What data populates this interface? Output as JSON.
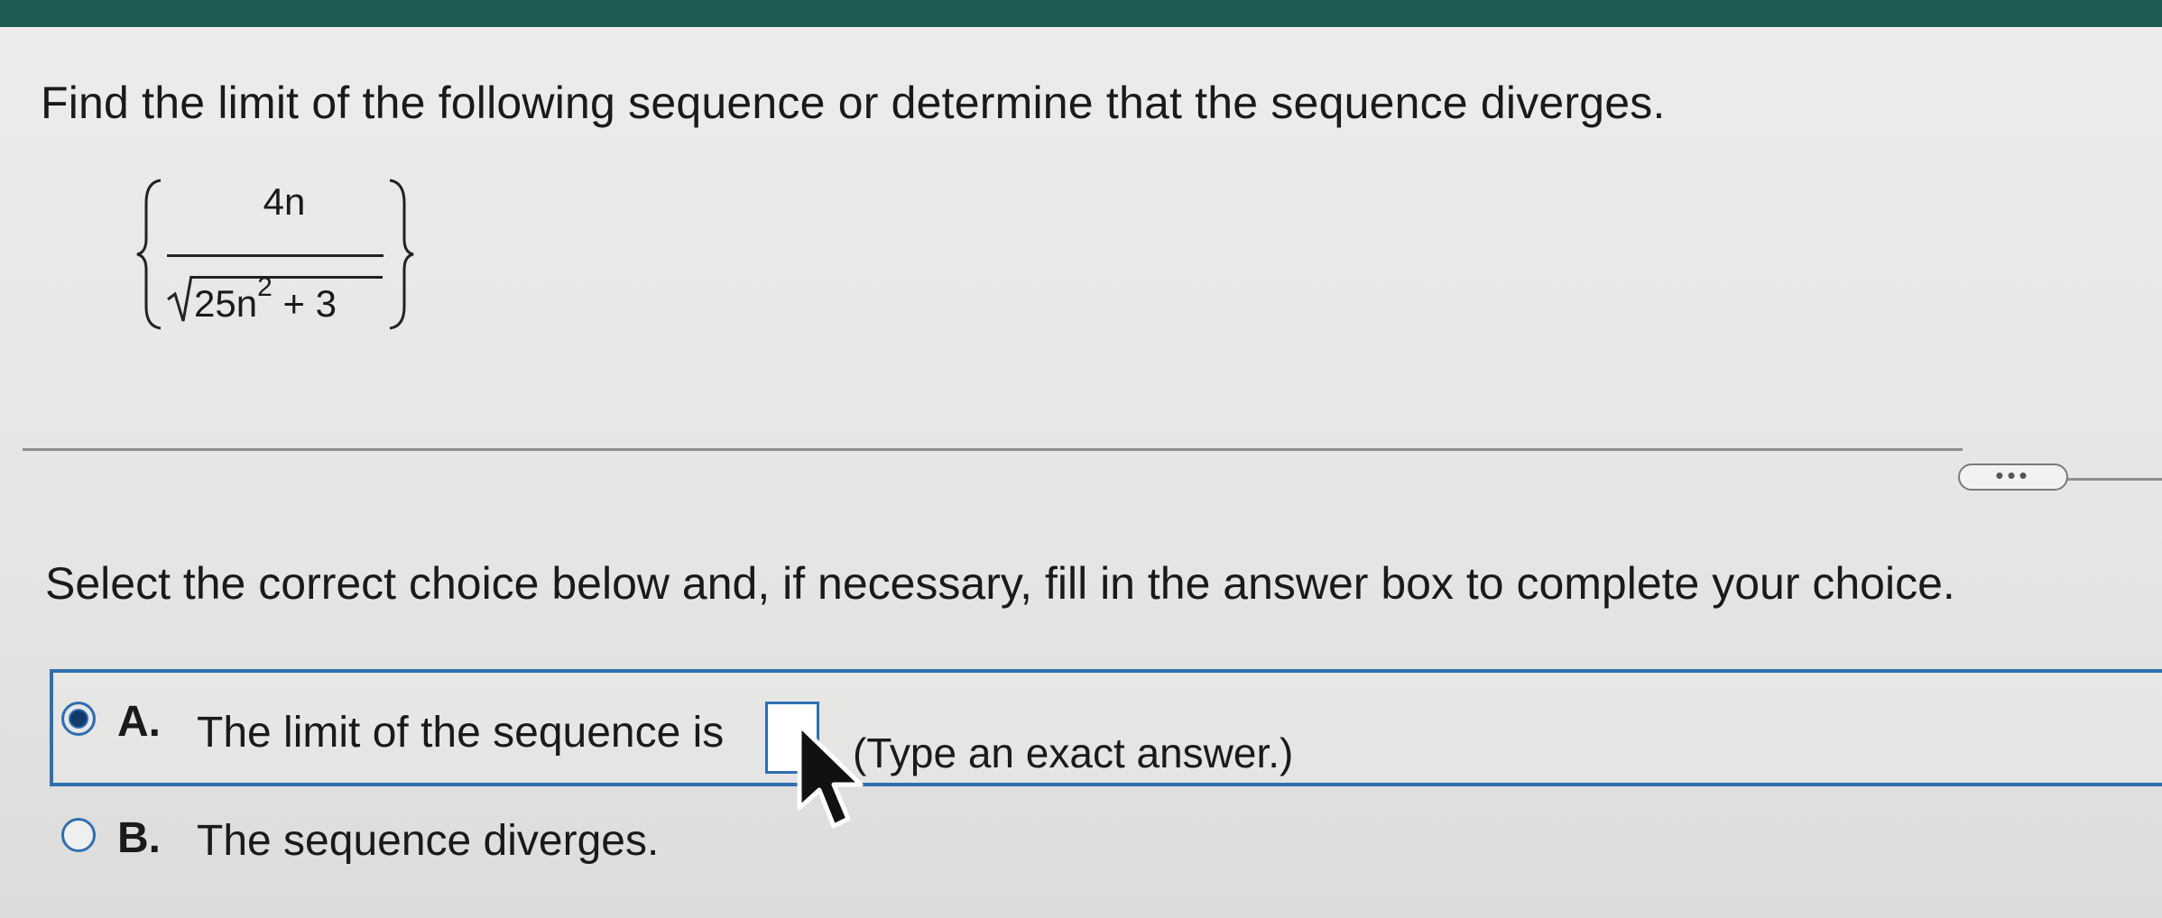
{
  "question": {
    "text": "Find the limit of the following sequence or determine that the sequence diverges.",
    "formula": {
      "numerator": "4n",
      "denominator_base": "25n",
      "denominator_exponent": "2",
      "denominator_rest": "+ 3"
    }
  },
  "more_button": {
    "label": "•••"
  },
  "instruction": "Select the correct choice below and, if necessary, fill in the answer box to complete your choice.",
  "choices": [
    {
      "letter": "A.",
      "text": "The limit of the sequence is",
      "hint": "(Type an exact answer.)",
      "selected": true,
      "answer_value": ""
    },
    {
      "letter": "B.",
      "text": "The sequence diverges.",
      "selected": false
    }
  ],
  "colors": {
    "top_bar": "#1f5c55",
    "accent": "#2f6fb0"
  },
  "icons": {
    "cursor": "mouse-pointer-icon"
  }
}
